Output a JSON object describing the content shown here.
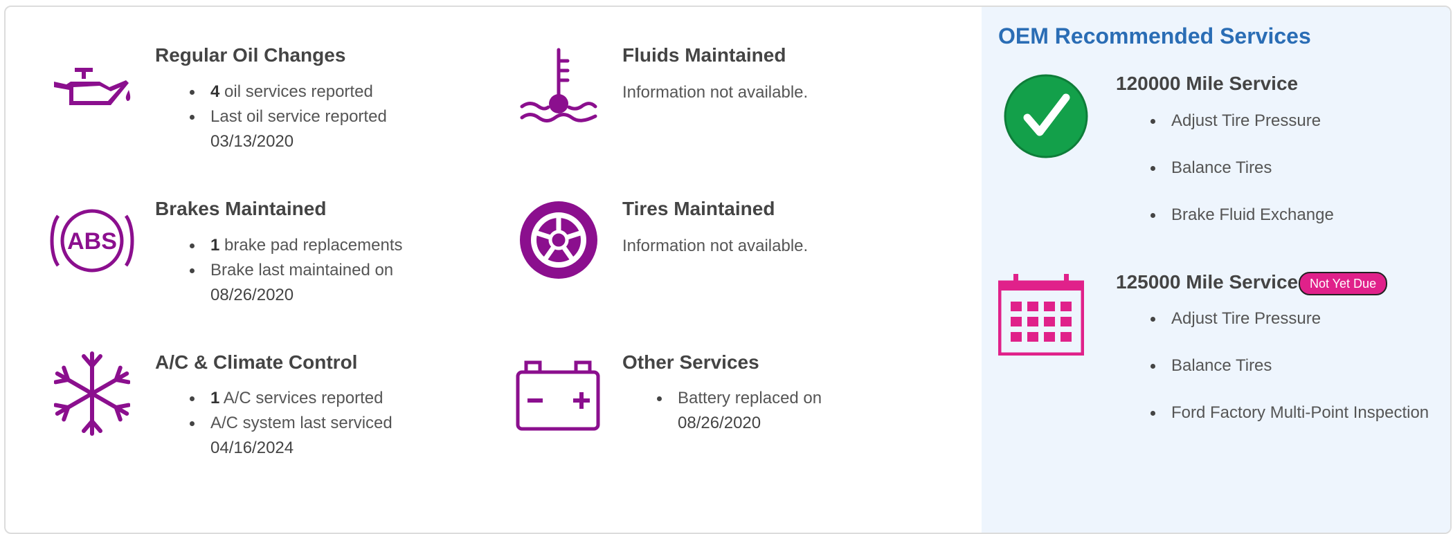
{
  "colors": {
    "icon_purple": "#8b0f8e",
    "oem_blue": "#2a6db5",
    "check_green": "#13a04a",
    "calendar_pink": "#e0218a",
    "badge_pink": "#e0218a",
    "panel_bg": "#eef5fd"
  },
  "services": {
    "oil": {
      "icon": "oil-can-icon",
      "title": "Regular Oil Changes",
      "count": "4",
      "count_text": " oil services reported",
      "last_label": "Last oil service reported",
      "last_date": "03/13/2020"
    },
    "fluids": {
      "icon": "thermometer-water-icon",
      "title": "Fluids Maintained",
      "info": "Information not available."
    },
    "brakes": {
      "icon": "abs-icon",
      "title": "Brakes Maintained",
      "count": "1",
      "count_text": " brake pad replacements",
      "last_label": "Brake last maintained on",
      "last_date": "08/26/2020"
    },
    "tires": {
      "icon": "wheel-icon",
      "title": "Tires Maintained",
      "info": "Information not available."
    },
    "ac": {
      "icon": "snowflake-icon",
      "title": "A/C & Climate Control",
      "count": "1",
      "count_text": " A/C services reported",
      "last_label": "A/C system last serviced",
      "last_date": "04/16/2024"
    },
    "other": {
      "icon": "battery-icon",
      "title": "Other Services",
      "last_label": "Battery replaced on",
      "last_date": "08/26/2020"
    }
  },
  "oem": {
    "heading": "OEM Recommended Services",
    "items": [
      {
        "icon": "checkmark-icon",
        "title": "120000 Mile Service",
        "tasks": [
          "Adjust Tire Pressure",
          "Balance Tires",
          "Brake Fluid Exchange"
        ]
      },
      {
        "icon": "calendar-icon",
        "title": "125000 Mile Service",
        "badge": "Not Yet Due",
        "tasks": [
          "Adjust Tire Pressure",
          "Balance Tires",
          "Ford Factory Multi-Point Inspection"
        ]
      }
    ]
  }
}
